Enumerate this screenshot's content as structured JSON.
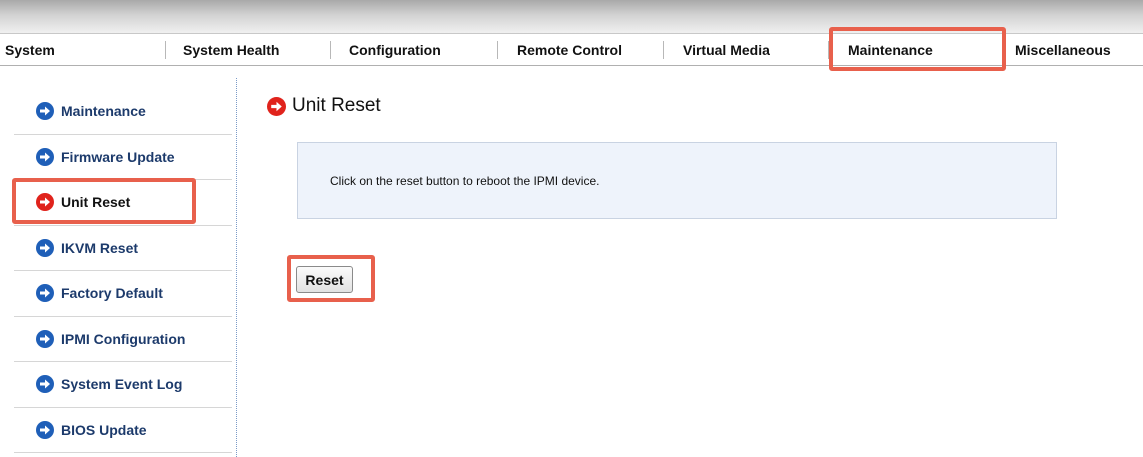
{
  "nav": {
    "items": [
      {
        "label": "System"
      },
      {
        "label": "System Health"
      },
      {
        "label": "Configuration"
      },
      {
        "label": "Remote Control"
      },
      {
        "label": "Virtual Media"
      },
      {
        "label": "Maintenance"
      },
      {
        "label": "Miscellaneous"
      }
    ],
    "active": "Maintenance"
  },
  "sidebar": {
    "items": [
      {
        "label": "Maintenance",
        "icon": "arrow-right-circle-icon"
      },
      {
        "label": "Firmware Update",
        "icon": "arrow-right-circle-icon"
      },
      {
        "label": "Unit Reset",
        "icon": "arrow-right-circle-icon"
      },
      {
        "label": "IKVM Reset",
        "icon": "arrow-right-circle-icon"
      },
      {
        "label": "Factory Default",
        "icon": "arrow-right-circle-icon"
      },
      {
        "label": "IPMI Configuration",
        "icon": "arrow-right-circle-icon"
      },
      {
        "label": "System Event Log",
        "icon": "arrow-right-circle-icon"
      },
      {
        "label": "BIOS Update",
        "icon": "arrow-right-circle-icon"
      }
    ],
    "active": "Unit Reset"
  },
  "main": {
    "title": "Unit Reset",
    "info_text": "Click on the reset button to reboot the IPMI device.",
    "reset_label": "Reset"
  },
  "colors": {
    "highlight": "#e8604c",
    "icon_blue": "#1f5fb8",
    "icon_active": "#e0231c",
    "info_bg": "#eef3fb"
  }
}
